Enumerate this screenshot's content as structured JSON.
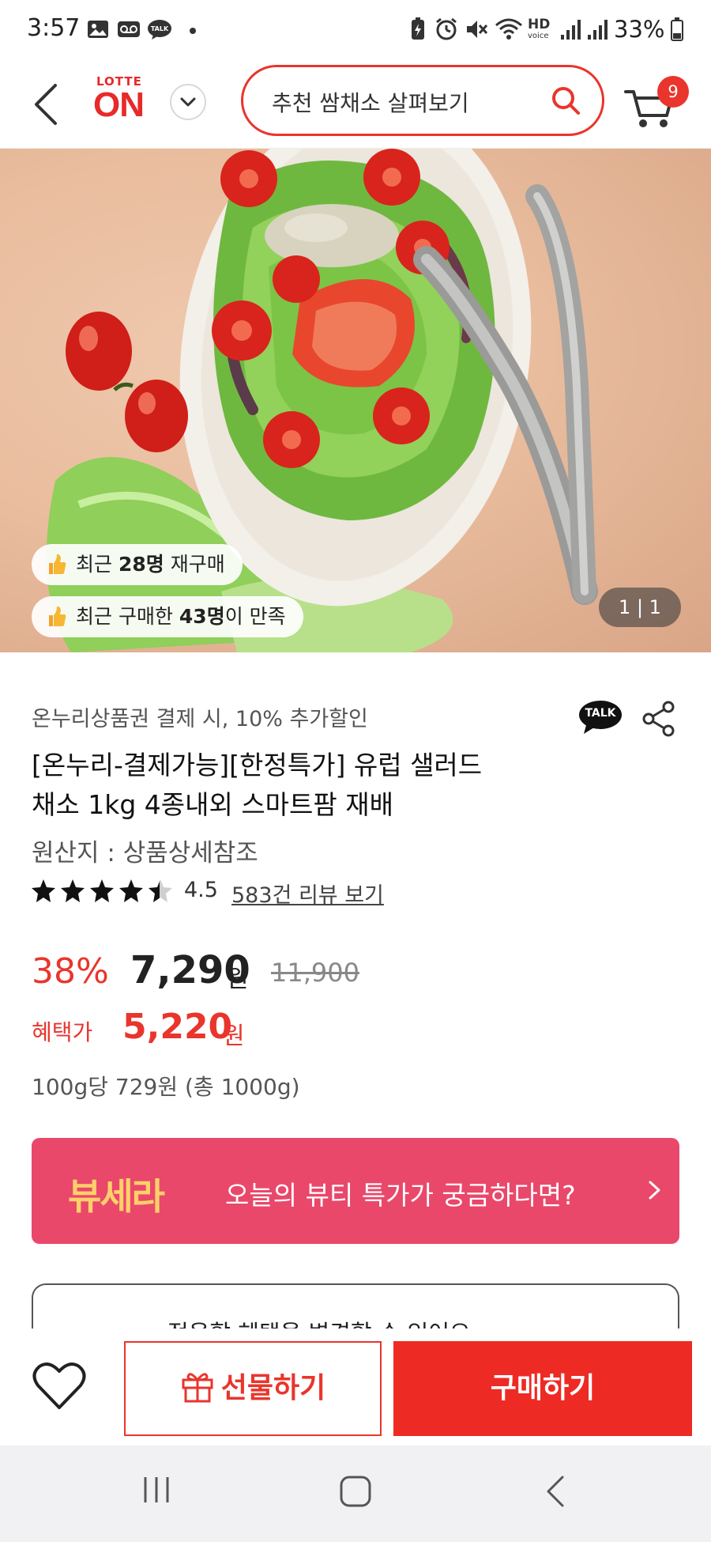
{
  "status_bar": {
    "time": "3:57",
    "battery": "33%",
    "hd_label": "HD",
    "voice_label": "voice",
    "talk_label": "TALK"
  },
  "header": {
    "logo_top": "LOTTE",
    "logo_main": "ON",
    "search_placeholder": "추천 쌈채소 살펴보기",
    "cart_count": "9"
  },
  "hero": {
    "chip_repurchase": {
      "prefix": "최근 ",
      "count": "28명",
      "suffix": " 재구매"
    },
    "chip_satisfied": {
      "prefix": "최근 구매한 ",
      "count": "43명",
      "suffix": "이 만족"
    },
    "page_indicator": "1 | 1"
  },
  "product": {
    "promo": "온누리상품권 결제 시, 10% 추가할인",
    "talk_label": "TALK",
    "title_line1": "[온누리-결제가능][한정특가] 유럽 샐러드",
    "title_line2": "채소 1kg 4종내외 스마트팜 재배",
    "origin": "원산지 : 상품상세참조",
    "rating": "4.5",
    "rating_value": 4.5,
    "review_link": "583건 리뷰 보기"
  },
  "price": {
    "discount_rate": "38%",
    "sale_price": "7,290",
    "sale_unit": "원",
    "original_price": "11,900",
    "benefit_label": "혜택가",
    "benefit_price": "5,220",
    "benefit_unit": "원",
    "unit_price": "100g당 729원 (총 1000g)"
  },
  "banner": {
    "brand": "뷰세라",
    "text": "오늘의 뷰티 특가가 궁금하다면?",
    "color": "#e9486b"
  },
  "benefit_change": {
    "text": "적용할 혜택을 변경할 수 있어요"
  },
  "actions": {
    "gift_label": "선물하기",
    "buy_label": "구매하기",
    "accent": "#ee2a24"
  },
  "icons": {
    "back": "chevron-left-icon",
    "dropdown": "chevron-down-icon",
    "search": "search-icon",
    "cart": "cart-icon",
    "share": "share-icon",
    "wish": "heart-icon",
    "gift": "gift-icon"
  }
}
